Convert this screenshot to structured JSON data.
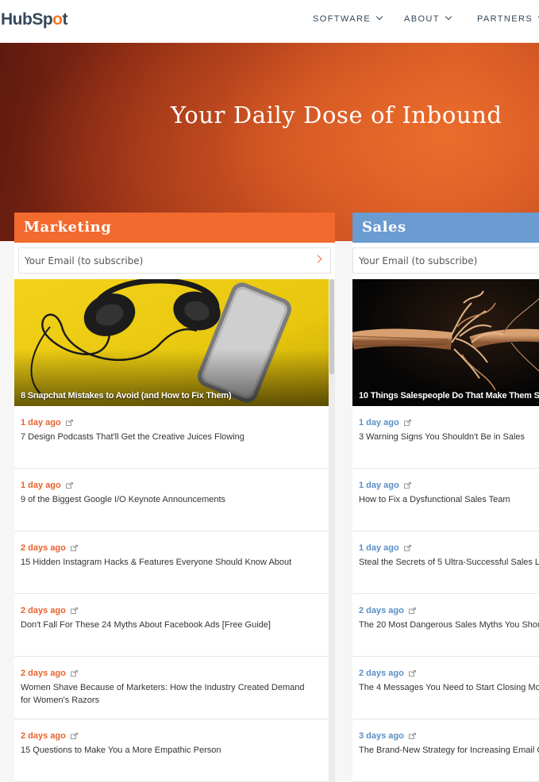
{
  "header": {
    "logo": {
      "part1": "HubSp",
      "part2": "o",
      "part3": "t"
    },
    "nav": [
      {
        "label": "SOFTWARE"
      },
      {
        "label": "ABOUT"
      },
      {
        "label": "PARTNERS"
      }
    ]
  },
  "hero": {
    "title": "Your Daily Dose of Inbound"
  },
  "columns": {
    "marketing": {
      "title": "Marketing",
      "email_placeholder": "Your Email (to subscribe)",
      "feature_title": "8 Snapchat Mistakes to Avoid (and How to Fix Them)",
      "items": [
        {
          "time": "1 day ago",
          "title": "7 Design Podcasts That'll Get the Creative Juices Flowing"
        },
        {
          "time": "1 day ago",
          "title": "9 of the Biggest Google I/O Keynote Announcements"
        },
        {
          "time": "2 days ago",
          "title": "15 Hidden Instagram Hacks & Features Everyone Should Know About"
        },
        {
          "time": "2 days ago",
          "title": "Don't Fall For These 24 Myths About Facebook Ads [Free Guide]"
        },
        {
          "time": "2 days ago",
          "title": "Women Shave Because of Marketers: How the Industry Created Demand for Women's Razors"
        },
        {
          "time": "2 days ago",
          "title": "15 Questions to Make You a More Empathic Person"
        }
      ]
    },
    "sales": {
      "title": "Sales",
      "email_placeholder": "Your Email (to subscribe)",
      "feature_title": "10 Things Salespeople Do That Make Them S",
      "items": [
        {
          "time": "1 day ago",
          "title": "3 Warning Signs You Shouldn't Be in Sales"
        },
        {
          "time": "1 day ago",
          "title": "How to Fix a Dysfunctional Sales Team"
        },
        {
          "time": "1 day ago",
          "title": "Steal the Secrets of 5 Ultra-Successful Sales L"
        },
        {
          "time": "2 days ago",
          "title": "The 20 Most Dangerous Sales Myths You Shou"
        },
        {
          "time": "2 days ago",
          "title": "The 4 Messages You Need to Start Closing Mo"
        },
        {
          "time": "3 days ago",
          "title": "The Brand-New Strategy for Increasing Email C"
        }
      ]
    }
  },
  "colors": {
    "marketing_accent": "#f26a2e",
    "sales_accent": "#6a9bd1",
    "logo_text": "#33475b",
    "logo_sprocket": "#f57722"
  },
  "icons": [
    "chevron-down-icon",
    "chevron-right-icon",
    "external-link-icon"
  ]
}
